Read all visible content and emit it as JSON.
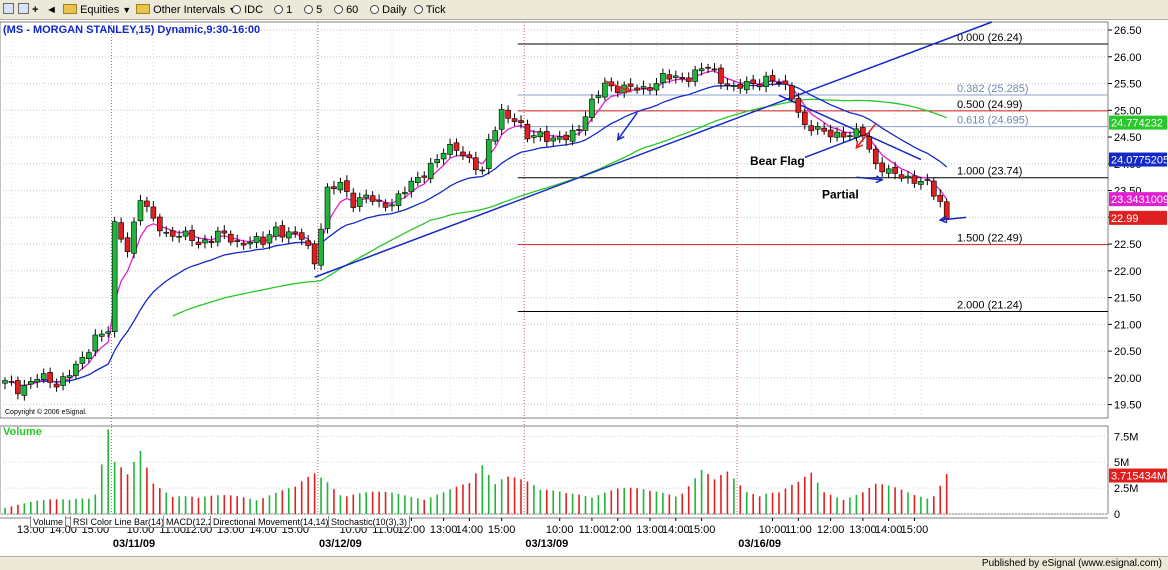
{
  "toolbar": {
    "equities": "Equities",
    "other_intervals": "Other Intervals",
    "idc": "IDC",
    "i1": "1",
    "i5": "5",
    "i60": "60",
    "daily": "Daily",
    "tick": "Tick"
  },
  "status": {
    "published": "Published by eSignal (www.esignal.com)"
  },
  "tabs": [
    "Volume",
    "RSI Color Line Bar(14)",
    "MACD(12,26,9,C)",
    "Directional Movement(14,14)",
    "Stochastic(10(3),3)"
  ],
  "colors": {
    "up": "#1fb53a",
    "down": "#e02020",
    "ma_fast": "#e020d0",
    "ma_mid": "#1428c8",
    "ma_slow": "#28c828",
    "fib_line": "#d02020",
    "trend": "#1428c8"
  },
  "chart_data": [
    {
      "type": "candlestick",
      "title": "(MS - MORGAN STANLEY,15) Dynamic,9:30-16:00",
      "copyright": "Copyright © 2006 eSignal.",
      "ylim": [
        19.25,
        26.65
      ],
      "y_ticks": [
        "19.50",
        "20.00",
        "20.50",
        "21.00",
        "21.50",
        "22.00",
        "22.50",
        "23.00",
        "23.50",
        "24.00",
        "24.50",
        "25.00",
        "25.50",
        "26.00",
        "26.50"
      ],
      "x_ticks": [
        "13:00",
        "14:00",
        "15:00",
        "10:00",
        "11:00",
        "12:00",
        "13:00",
        "14:00",
        "15:00",
        "10:00",
        "11:00",
        "12:00",
        "13:00",
        "14:00",
        "15:00",
        "10:00",
        "11:00",
        "12:00",
        "13:00",
        "14:00",
        "15:00",
        "10:00",
        "11:00",
        "12:00",
        "13:00",
        "14:00",
        "15:00"
      ],
      "date_labels": [
        "03/11/09",
        "03/12/09",
        "03/13/09",
        "03/16/09"
      ],
      "last_price_tags": [
        {
          "label": "24.774232",
          "value": 24.77,
          "color": "#28c828"
        },
        {
          "label": "24.0775205",
          "value": 24.08,
          "color": "#1428c8"
        },
        {
          "label": "23.3431009",
          "value": 23.34,
          "color": "#e020d0"
        },
        {
          "label": "22.99",
          "value": 22.99,
          "color": "#e02020"
        }
      ],
      "fib_levels": [
        {
          "label": "0.000 (26.24)",
          "value": 26.24,
          "color": "#000000"
        },
        {
          "label": "0.382 (25.285)",
          "value": 25.285,
          "color": "#8aa0c8"
        },
        {
          "label": "0.500 (24.99)",
          "value": 24.99,
          "color": "#d02020"
        },
        {
          "label": "0.618 (24.695)",
          "value": 24.695,
          "color": "#8aa0c8"
        },
        {
          "label": "1.000 (23.74)",
          "value": 23.74,
          "color": "#000000"
        },
        {
          "label": "1.500 (22.49)",
          "value": 22.49,
          "color": "#d02020"
        },
        {
          "label": "2.000 (21.24)",
          "value": 21.24,
          "color": "#000000"
        }
      ],
      "annotations": [
        "Bear Flag",
        "Partial"
      ],
      "waypoints": [
        [
          0,
          19.9
        ],
        [
          2,
          19.8
        ],
        [
          5,
          20.0
        ],
        [
          8,
          19.9
        ],
        [
          10,
          20.1
        ],
        [
          12,
          20.3
        ],
        [
          14,
          20.8
        ],
        [
          16,
          20.9
        ],
        [
          17,
          22.8
        ],
        [
          19,
          22.4
        ],
        [
          21,
          23.4
        ],
        [
          23,
          22.9
        ],
        [
          25,
          22.7
        ],
        [
          27,
          22.7
        ],
        [
          30,
          22.5
        ],
        [
          33,
          22.7
        ],
        [
          36,
          22.5
        ],
        [
          38,
          22.6
        ],
        [
          40,
          22.5
        ],
        [
          42,
          22.8
        ],
        [
          44,
          22.7
        ],
        [
          46,
          22.6
        ],
        [
          48,
          22.2
        ],
        [
          50,
          23.5
        ],
        [
          52,
          23.6
        ],
        [
          54,
          23.3
        ],
        [
          56,
          23.4
        ],
        [
          58,
          23.2
        ],
        [
          60,
          23.3
        ],
        [
          62,
          23.5
        ],
        [
          64,
          23.7
        ],
        [
          66,
          24.0
        ],
        [
          68,
          24.2
        ],
        [
          70,
          24.3
        ],
        [
          72,
          24.1
        ],
        [
          74,
          23.8
        ],
        [
          75,
          24.4
        ],
        [
          77,
          25.0
        ],
        [
          79,
          24.8
        ],
        [
          81,
          24.5
        ],
        [
          83,
          24.6
        ],
        [
          85,
          24.4
        ],
        [
          87,
          24.5
        ],
        [
          89,
          24.7
        ],
        [
          91,
          25.1
        ],
        [
          93,
          25.5
        ],
        [
          96,
          25.4
        ],
        [
          99,
          25.4
        ],
        [
          102,
          25.6
        ],
        [
          105,
          25.6
        ],
        [
          107,
          25.7
        ],
        [
          109,
          25.8
        ],
        [
          111,
          25.6
        ],
        [
          113,
          25.4
        ],
        [
          116,
          25.5
        ],
        [
          118,
          25.6
        ],
        [
          120,
          25.5
        ],
        [
          122,
          25.3
        ],
        [
          124,
          24.7
        ],
        [
          126,
          24.6
        ],
        [
          128,
          24.6
        ],
        [
          131,
          24.5
        ],
        [
          133,
          24.6
        ],
        [
          135,
          24.0
        ],
        [
          137,
          23.8
        ],
        [
          139,
          23.8
        ],
        [
          141,
          23.7
        ],
        [
          143,
          23.6
        ],
        [
          145,
          23.3
        ],
        [
          146,
          23.0
        ]
      ],
      "trendlines": [
        {
          "from": [
            48,
            21.88
          ],
          "to": [
            153,
            26.65
          ]
        },
        {
          "from": [
            120,
            25.28
          ],
          "to": [
            142,
            24.08
          ]
        },
        {
          "from": [
            124,
            24.12
          ],
          "to": [
            134,
            24.58
          ]
        }
      ]
    },
    {
      "type": "bar",
      "title": "Volume",
      "y_ticks": [
        "0",
        "2.5M",
        "5M",
        "7.5M"
      ],
      "ylim": [
        0,
        8500000
      ],
      "last_value_label": "3.715434M",
      "waypoints": [
        [
          0,
          0.8
        ],
        [
          5,
          1.1
        ],
        [
          10,
          1.3
        ],
        [
          14,
          2.2
        ],
        [
          16,
          7.8
        ],
        [
          17,
          4.5
        ],
        [
          19,
          3.2
        ],
        [
          21,
          5.2
        ],
        [
          23,
          2.8
        ],
        [
          26,
          2.2
        ],
        [
          30,
          1.4
        ],
        [
          35,
          1.6
        ],
        [
          40,
          1.8
        ],
        [
          45,
          2.2
        ],
        [
          48,
          3.5
        ],
        [
          50,
          3.2
        ],
        [
          53,
          2.0
        ],
        [
          58,
          1.8
        ],
        [
          63,
          1.7
        ],
        [
          68,
          2.0
        ],
        [
          72,
          2.5
        ],
        [
          74,
          4.2
        ],
        [
          76,
          3.0
        ],
        [
          78,
          4.8
        ],
        [
          80,
          3.5
        ],
        [
          83,
          2.0
        ],
        [
          87,
          1.8
        ],
        [
          91,
          2.1
        ],
        [
          95,
          2.2
        ],
        [
          100,
          2.0
        ],
        [
          105,
          2.3
        ],
        [
          108,
          3.8
        ],
        [
          110,
          2.8
        ],
        [
          112,
          3.5
        ],
        [
          115,
          2.2
        ],
        [
          118,
          2.3
        ],
        [
          120,
          2.0
        ],
        [
          123,
          2.6
        ],
        [
          125,
          3.4
        ],
        [
          127,
          2.0
        ],
        [
          130,
          1.8
        ],
        [
          133,
          2.0
        ],
        [
          135,
          2.5
        ],
        [
          138,
          2.2
        ],
        [
          141,
          1.9
        ],
        [
          144,
          2.0
        ],
        [
          146,
          3.7
        ]
      ]
    }
  ]
}
